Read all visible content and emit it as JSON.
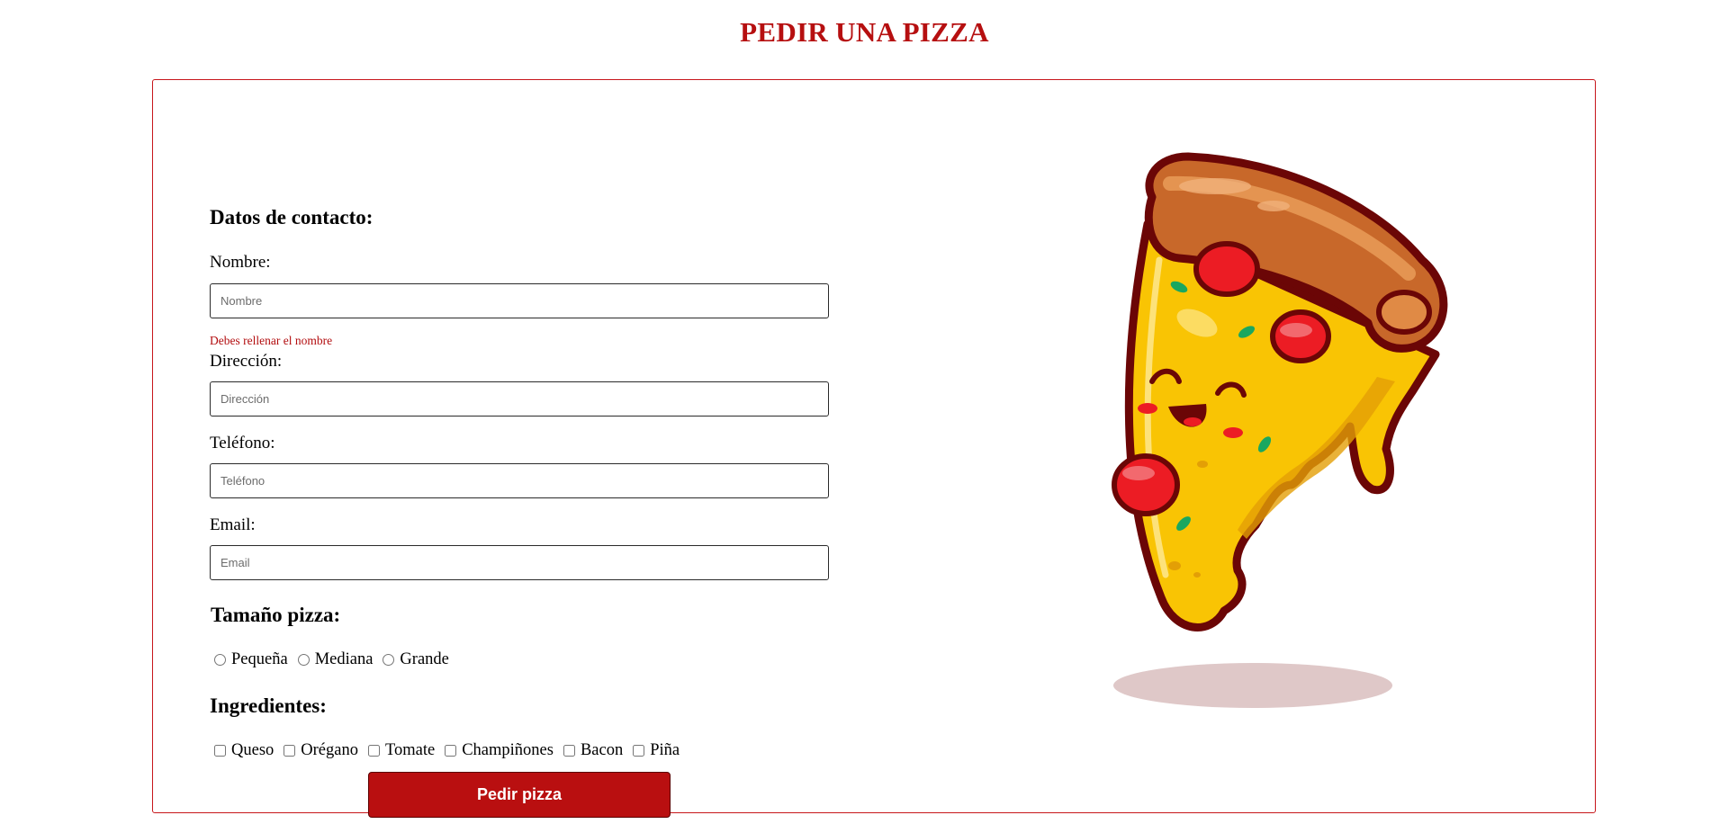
{
  "page": {
    "title": "PEDIR UNA PIZZA"
  },
  "contact": {
    "heading": "Datos de contacto:",
    "name": {
      "label": "Nombre:",
      "placeholder": "Nombre",
      "value": "",
      "error": "Debes rellenar el nombre"
    },
    "address": {
      "label": "Dirección:",
      "placeholder": "Dirección",
      "value": ""
    },
    "phone": {
      "label": "Teléfono:",
      "placeholder": "Teléfono",
      "value": ""
    },
    "email": {
      "label": "Email:",
      "placeholder": "Email",
      "value": ""
    }
  },
  "size": {
    "heading": "Tamaño pizza:",
    "options": [
      "Pequeña",
      "Mediana",
      "Grande"
    ],
    "selected": null
  },
  "ingredients": {
    "heading": "Ingredientes:",
    "options": [
      "Queso",
      "Orégano",
      "Tomate",
      "Champiñones",
      "Bacon",
      "Piña"
    ],
    "checked": []
  },
  "submit": {
    "label": "Pedir pizza"
  },
  "colors": {
    "accent": "#b90f10",
    "border": "#c7161b",
    "error": "#b20c0e"
  },
  "illustration": {
    "icon": "pizza-slice-mascot-icon"
  }
}
